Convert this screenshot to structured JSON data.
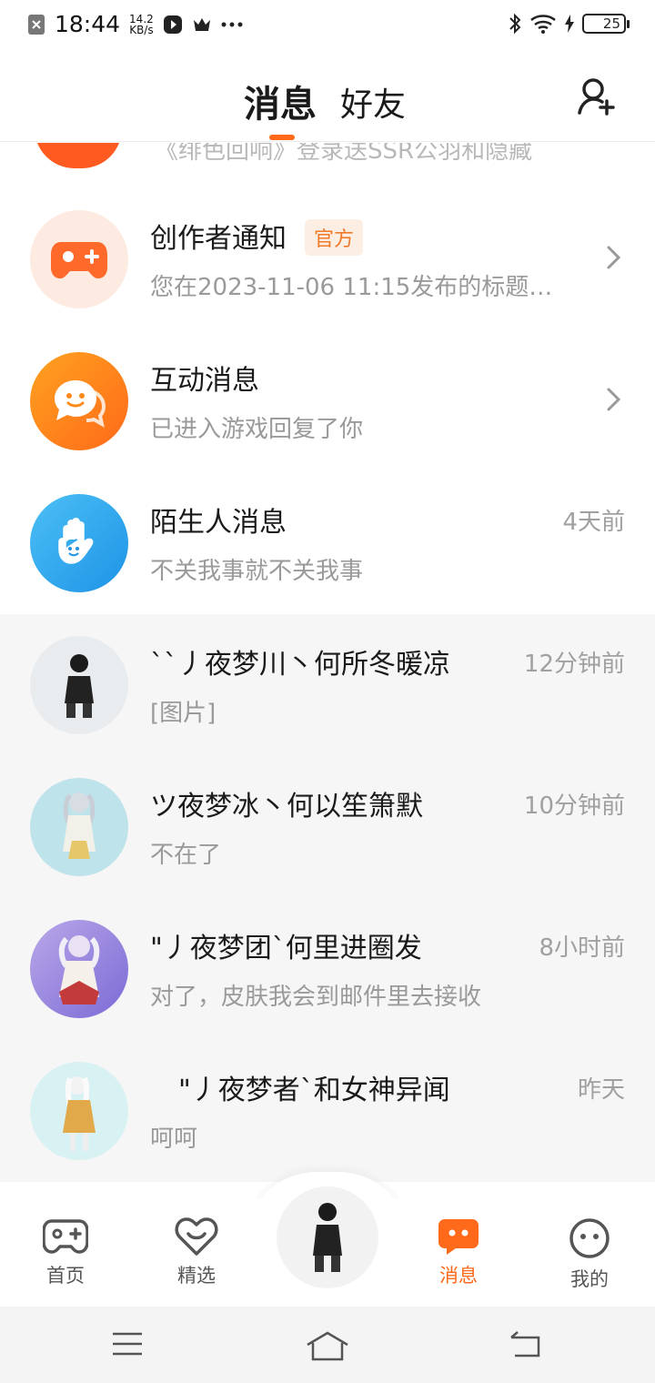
{
  "status_bar": {
    "time": "18:44",
    "speed_value": "14.2",
    "speed_unit": "KB/s",
    "battery": "25",
    "icons": [
      "close-box-icon",
      "play-icon",
      "crown-icon",
      "more-dots-icon",
      "bluetooth-icon",
      "wifi-icon",
      "charging-icon",
      "battery-icon"
    ]
  },
  "header": {
    "tabs": [
      {
        "label": "消息",
        "active": true
      },
      {
        "label": "好友",
        "active": false
      }
    ],
    "add_friend_icon": "add-friend-icon"
  },
  "partial_row": {
    "text": "《绯色回响》登录送SSR公羽和隐藏"
  },
  "system_rows": [
    {
      "title": "创作者通知",
      "badge": "官方",
      "subtitle": "您在2023-11-06 11:15发布的标题…",
      "icon": "gamepad-icon",
      "color": "#ff6a2a"
    },
    {
      "title": "互动消息",
      "subtitle": "已进入游戏回复了你",
      "icon": "chat-bubble-icon",
      "color": "#ff8a1a"
    },
    {
      "title": "陌生人消息",
      "subtitle": "不关我事就不关我事",
      "time": "4天前",
      "icon": "waving-hand-icon",
      "color": "#2fa7f0"
    }
  ],
  "chats": [
    {
      "name": "``丿夜梦川丶何所冬暖凉",
      "preview": "[图片]",
      "time": "12分钟前"
    },
    {
      "name": "ツ夜梦冰丶何以笙箫默",
      "preview": "不在了",
      "time": "10分钟前"
    },
    {
      "name": "\"丿夜梦团`何里进圈发",
      "preview": "对了，皮肤我会到邮件里去接收",
      "time": "8小时前"
    },
    {
      "name": "\"丿夜梦者`和女神异闻",
      "preview": "呵呵",
      "time": "昨天"
    }
  ],
  "bottom_nav": {
    "items": [
      {
        "label": "首页",
        "icon": "gamepad-outline-icon",
        "active": false
      },
      {
        "label": "精选",
        "icon": "heart-smile-icon",
        "active": false
      },
      {
        "label": "消息",
        "icon": "message-icon",
        "active": true
      },
      {
        "label": "我的",
        "icon": "face-icon",
        "active": false
      }
    ],
    "accent": "#ff6a1a"
  },
  "system_nav": {
    "icons": [
      "menu-icon",
      "home-icon",
      "back-icon"
    ]
  }
}
